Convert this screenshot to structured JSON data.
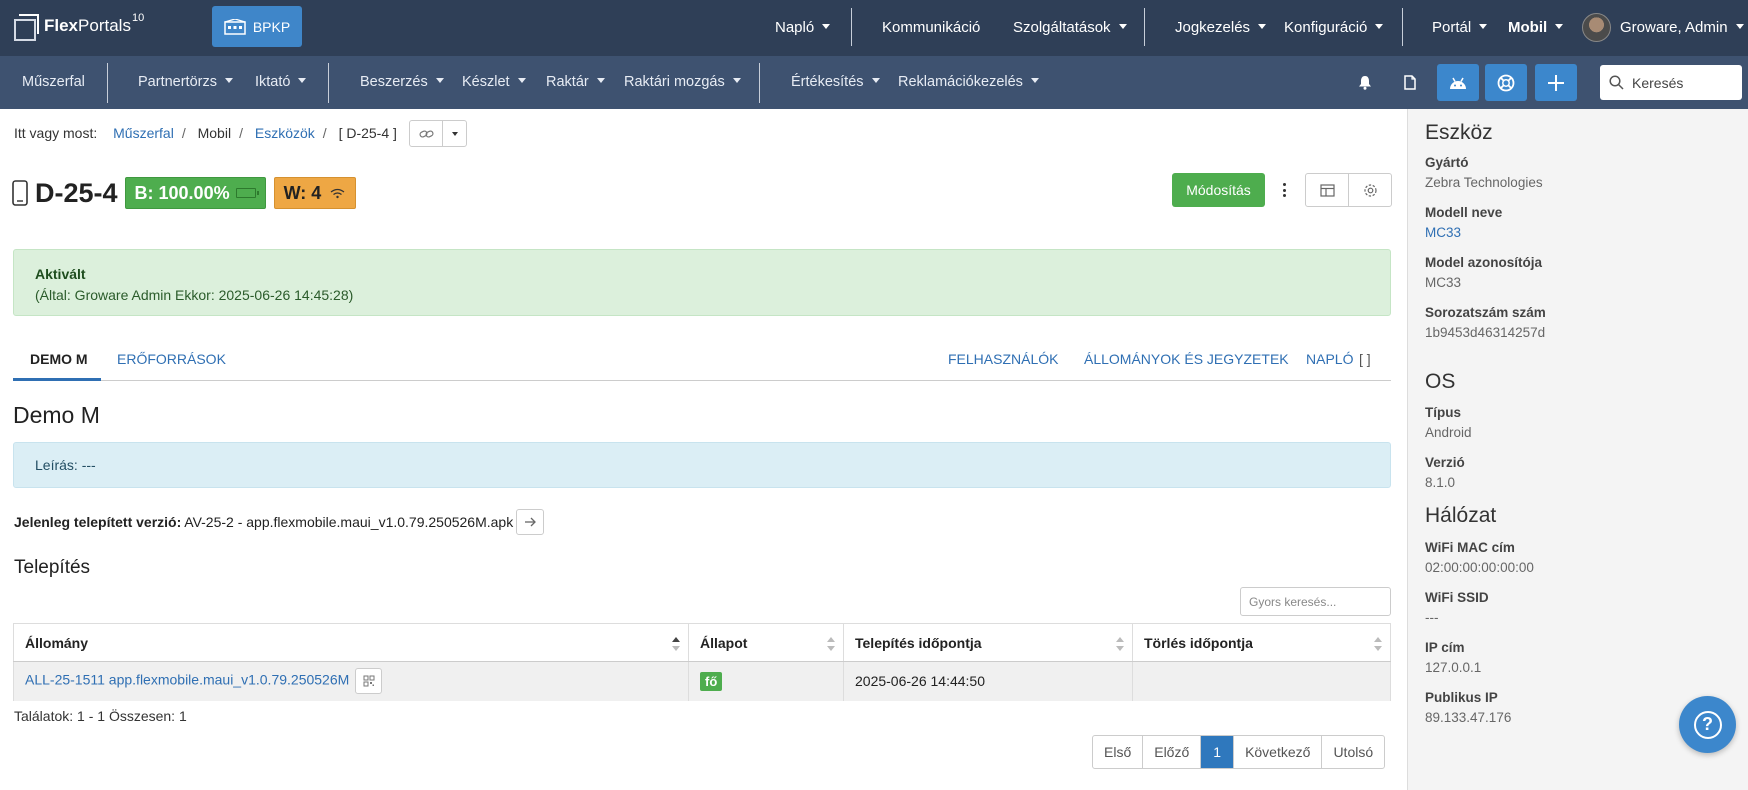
{
  "topnav": {
    "brand_bold": "Flex",
    "brand_rest": "Portals",
    "brand_sup": "10",
    "bpkp": "BPKP",
    "naplo": "Napló",
    "kommunikacio": "Kommunikáció",
    "szolgaltatasok": "Szolgáltatások",
    "jogkezeles": "Jogkezelés",
    "konfiguracio": "Konfiguráció",
    "portal": "Portál",
    "mobil": "Mobil",
    "user": "Groware, Admin"
  },
  "subnav": {
    "muszerfal": "Műszerfal",
    "partnertorzs": "Partnertörzs",
    "iktato": "Iktató",
    "beszerzes": "Beszerzés",
    "keszlet": "Készlet",
    "raktar": "Raktár",
    "raktari_mozgas": "Raktári mozgás",
    "ertekesites": "Értékesítés",
    "reklamaciokezeles": "Reklamációkezelés",
    "search_placeholder": "Keresés"
  },
  "breadcrumb": {
    "prefix": "Itt vagy most:",
    "items": [
      "Műszerfal",
      "Mobil",
      "Eszközök",
      "[ D-25-4 ]"
    ]
  },
  "device": {
    "id": "D-25-4",
    "battery": "B: 100.00%",
    "wifi": "W: 4",
    "edit_label": "Módosítás"
  },
  "status": {
    "title": "Aktivált",
    "detail": "(Által: Groware Admin Ekkor: 2025-06-26 14:45:28)"
  },
  "tabs": {
    "demo": "DEMO M",
    "eroforrasok": "ERŐFORRÁSOK",
    "felhasznalok": "FELHASZNÁLÓK",
    "allomanyok": "ÁLLOMÁNYOK ÉS JEGYZETEK",
    "naplo": "NAPLÓ"
  },
  "section": {
    "title": "Demo M",
    "description": "Leírás: ---",
    "installed_label": "Jelenleg telepített verzió:",
    "installed_value": "AV-25-2 - app.flexmobile.maui_v1.0.79.250526M.apk",
    "install_title": "Telepítés",
    "quick_search_placeholder": "Gyors keresés..."
  },
  "table": {
    "headers": [
      "Állomány",
      "Állapot",
      "Telepítés időpontja",
      "Törlés időpontja"
    ],
    "rows": [
      {
        "file": "ALL-25-1511 app.flexmobile.maui_v1.0.79.250526M",
        "status": "fő",
        "installed": "2025-06-26 14:44:50",
        "deleted": ""
      }
    ],
    "results": "Találatok: 1 - 1 Összesen: 1"
  },
  "pager": {
    "first": "Első",
    "prev": "Előző",
    "current": "1",
    "next": "Következő",
    "last": "Utolsó"
  },
  "sidebar": {
    "eszkoz": "Eszköz",
    "gyarto_label": "Gyártó",
    "gyarto": "Zebra Technologies",
    "modell_label": "Modell neve",
    "modell": "MC33",
    "modelid_label": "Model azonosítója",
    "modelid": "MC33",
    "serial_label": "Sorozatszám szám",
    "serial": "1b9453d46314257d",
    "os": "OS",
    "tipus_label": "Típus",
    "tipus": "Android",
    "verzio_label": "Verzió",
    "verzio": "8.1.0",
    "halozat": "Hálózat",
    "mac_label": "WiFi MAC cím",
    "mac": "02:00:00:00:00:00",
    "ssid_label": "WiFi SSID",
    "ssid": "---",
    "ip_label": "IP cím",
    "ip": "127.0.0.1",
    "pubip_label": "Publikus IP",
    "pubip": "89.133.47.176"
  },
  "colors": {
    "topnav": "#2f3f57",
    "subnav": "#3e5270",
    "accent": "#3c87cc",
    "success": "#4ead4e",
    "warning": "#eea744"
  },
  "icons": [
    "building-icon",
    "bell-icon",
    "document-icon",
    "android-icon",
    "lifebuoy-icon",
    "plus-icon",
    "search-icon",
    "link-icon",
    "phone-icon",
    "battery-icon",
    "wifi-icon",
    "layout-icon",
    "gear-icon",
    "arrow-right-icon",
    "qr-icon",
    "help-icon"
  ]
}
